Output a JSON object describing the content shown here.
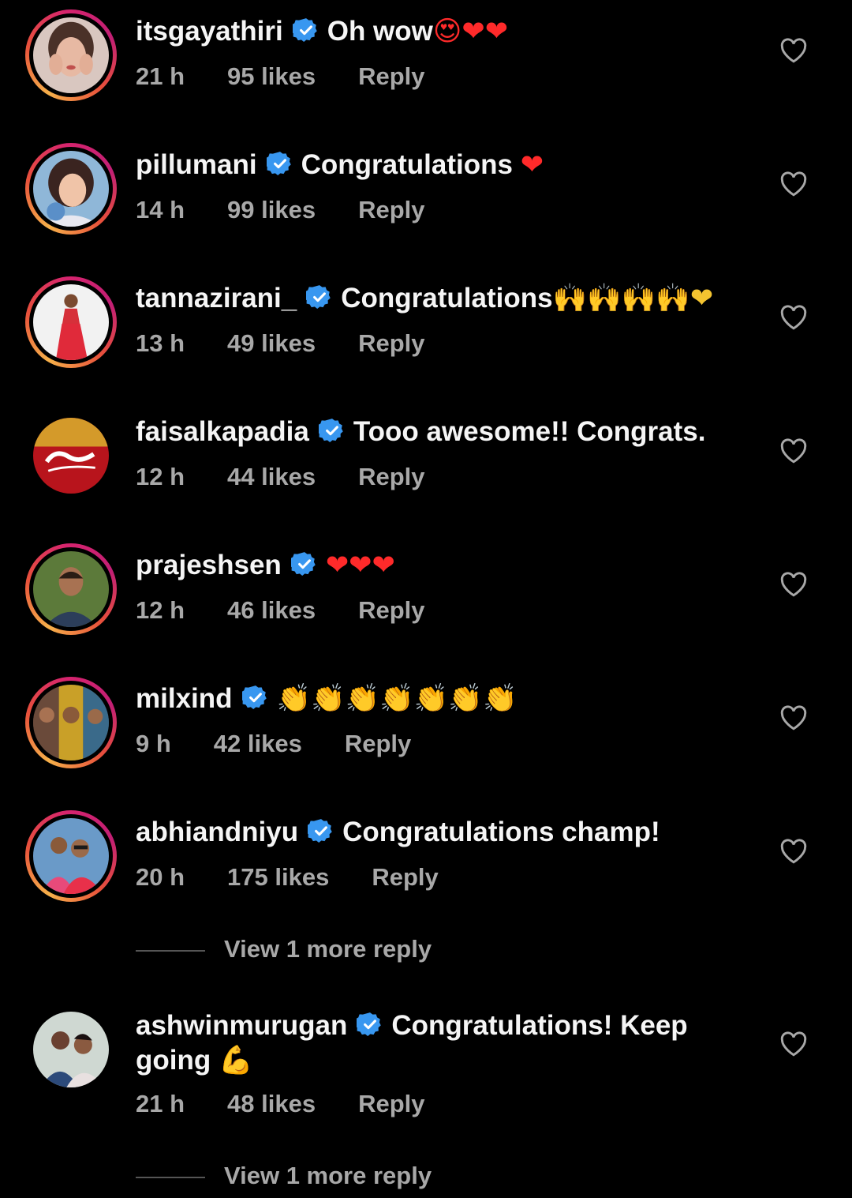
{
  "comments": [
    {
      "username": "itsgayathiri",
      "text": "Oh wow",
      "emoji": "😍❤❤",
      "time": "21 h",
      "likes": "95 likes",
      "reply": "Reply",
      "ring": true
    },
    {
      "username": "pillumani",
      "text": "Congratulations ",
      "emoji": "❤",
      "time": "14 h",
      "likes": "99 likes",
      "reply": "Reply",
      "ring": true
    },
    {
      "username": "tannazirani_",
      "text": "Congratulations",
      "emoji": "🙌🙌🙌🙌❤",
      "time": "13 h",
      "likes": "49 likes",
      "reply": "Reply",
      "ring": true
    },
    {
      "username": "faisalkapadia",
      "text": "Tooo awesome!! Congrats.",
      "emoji": "",
      "time": "12 h",
      "likes": "44 likes",
      "reply": "Reply",
      "ring": false
    },
    {
      "username": "prajeshsen",
      "text": "",
      "emoji": "❤❤❤",
      "time": "12 h",
      "likes": "46 likes",
      "reply": "Reply",
      "ring": true
    },
    {
      "username": "milxind",
      "text": "",
      "emoji": "👏👏👏👏👏👏👏",
      "time": "9 h",
      "likes": "42 likes",
      "reply": "Reply",
      "ring": true
    },
    {
      "username": "abhiandniyu",
      "text": "Congratulations champ!",
      "emoji": "",
      "time": "20 h",
      "likes": "175 likes",
      "reply": "Reply",
      "ring": true
    },
    {
      "username": "ashwinmurugan",
      "text": "Congratulations! Keep going ",
      "emoji": "💪",
      "time": "21 h",
      "likes": "48 likes",
      "reply": "Reply",
      "ring": false
    }
  ],
  "view_more_replies": [
    {
      "label": "View 1 more reply"
    },
    {
      "label": "View 1 more reply"
    }
  ],
  "colors": {
    "background": "#000000",
    "primary_text": "#f5f5f5",
    "secondary_text": "#a8a8a8",
    "verified_badge": "#3897f0",
    "story_ring": "#d6246e"
  },
  "icons": {
    "verified": "verified-badge-icon",
    "like": "heart-outline-icon"
  }
}
